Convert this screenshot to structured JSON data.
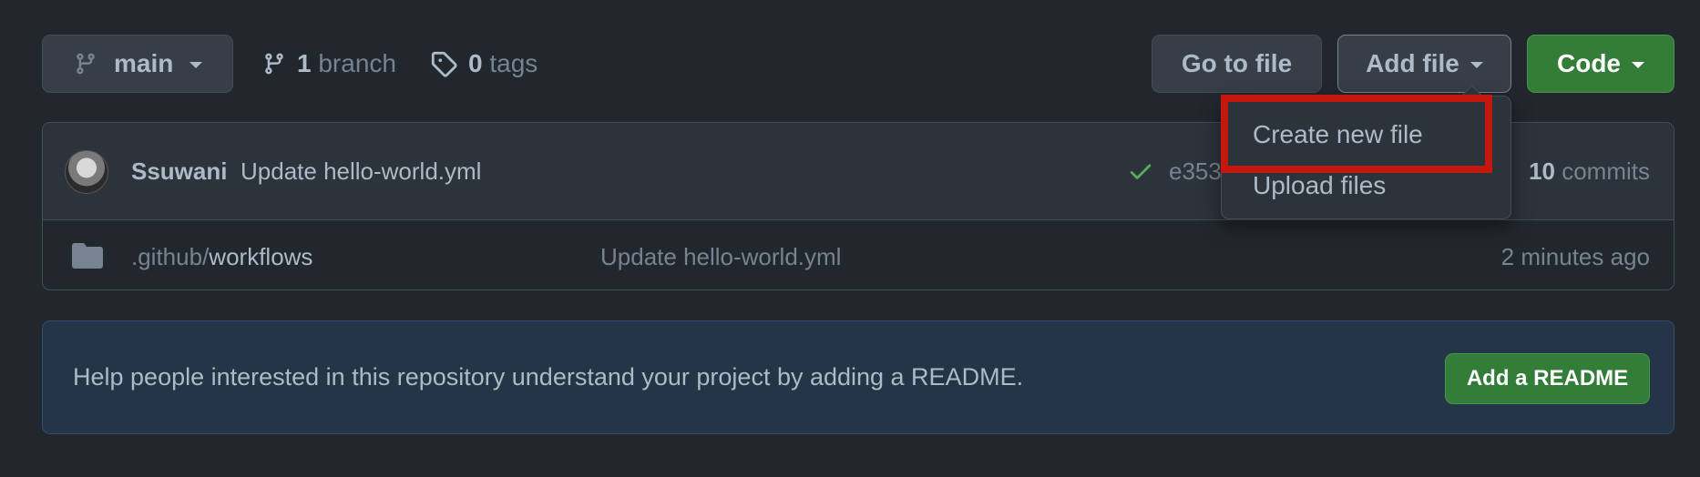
{
  "toolbar": {
    "branch": {
      "label": "main"
    },
    "branches": {
      "count": "1",
      "label": "branch"
    },
    "tags": {
      "count": "0",
      "label": "tags"
    },
    "go_to_file": "Go to file",
    "add_file": "Add file",
    "code": "Code"
  },
  "add_file_menu": {
    "items": [
      {
        "label": "Create new file"
      },
      {
        "label": "Upload files"
      }
    ],
    "highlighted": "Create new file"
  },
  "latest_commit": {
    "author": "Ssuwani",
    "message": "Update hello-world.yml",
    "status_icon": "check-icon",
    "sha_partial": "e353",
    "commits_count": "10",
    "commits_label": "commits"
  },
  "files": [
    {
      "type": "folder-icon",
      "path_prefix": ".github/",
      "path_leaf": "workflows",
      "commit_message": "Update hello-world.yml",
      "age": "2 minutes ago"
    }
  ],
  "readme_banner": {
    "text": "Help people interested in this repository understand your project by adding a README.",
    "button": "Add a README"
  },
  "colors": {
    "background": "#22272e",
    "primary_button": "#347d39",
    "highlight_border": "#c4180f",
    "success_check": "#57ab5a"
  }
}
